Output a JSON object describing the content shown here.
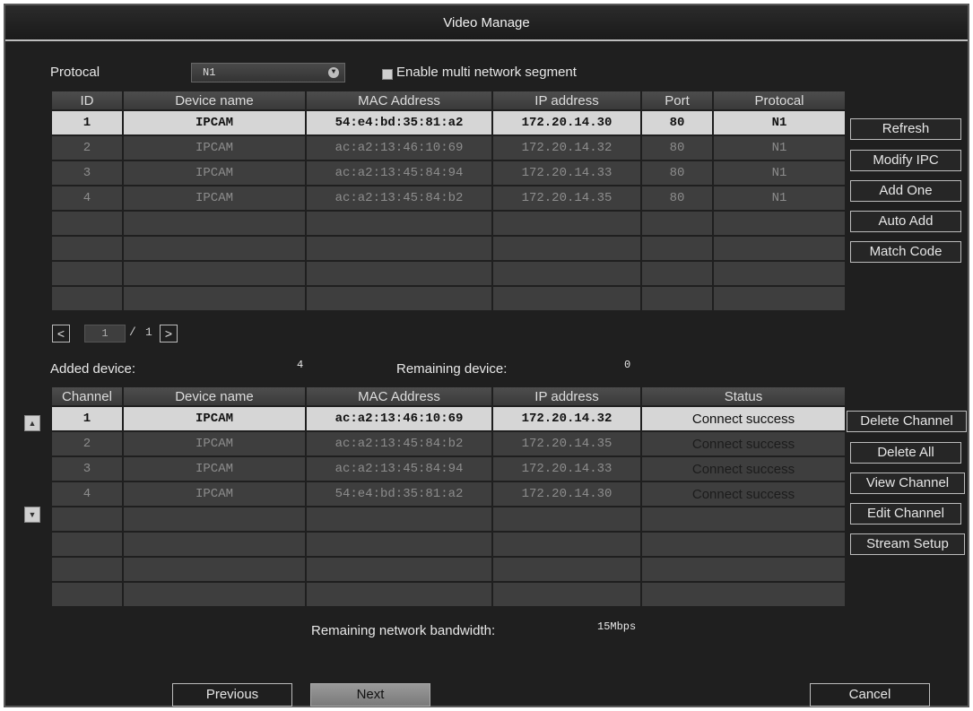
{
  "window": {
    "title": "Video Manage"
  },
  "search": {
    "protocol_label": "Protocal",
    "protocol_value": "N1",
    "multi_segment_label": "Enable multi network segment",
    "multi_segment_checked": true
  },
  "search_table": {
    "headers": [
      "ID",
      "Device name",
      "MAC Address",
      "IP address",
      "Port",
      "Protocal"
    ],
    "rows": [
      [
        "1",
        "IPCAM",
        "54:e4:bd:35:81:a2",
        "172.20.14.30",
        "80",
        "N1"
      ],
      [
        "2",
        "IPCAM",
        "ac:a2:13:46:10:69",
        "172.20.14.32",
        "80",
        "N1"
      ],
      [
        "3",
        "IPCAM",
        "ac:a2:13:45:84:94",
        "172.20.14.33",
        "80",
        "N1"
      ],
      [
        "4",
        "IPCAM",
        "ac:a2:13:45:84:b2",
        "172.20.14.35",
        "80",
        "N1"
      ]
    ],
    "selected_row": 0
  },
  "search_buttons": {
    "refresh": "Refresh",
    "modify_ipc": "Modify IPC",
    "add_one": "Add One",
    "auto_add": "Auto Add",
    "match_code": "Match Code"
  },
  "pager": {
    "prev": "<",
    "current": "1",
    "separator": "/",
    "total": "1",
    "next": ">"
  },
  "summary": {
    "added_label": "Added device:",
    "added_count": "4",
    "remaining_label": "Remaining device:",
    "remaining_count": "0"
  },
  "channel_table": {
    "headers": [
      "Channel",
      "Device name",
      "MAC Address",
      "IP address",
      "Status"
    ],
    "rows": [
      [
        "1",
        "IPCAM",
        "ac:a2:13:46:10:69",
        "172.20.14.32",
        "Connect success"
      ],
      [
        "2",
        "IPCAM",
        "ac:a2:13:45:84:b2",
        "172.20.14.35",
        "Connect success"
      ],
      [
        "3",
        "IPCAM",
        "ac:a2:13:45:84:94",
        "172.20.14.33",
        "Connect success"
      ],
      [
        "4",
        "IPCAM",
        "54:e4:bd:35:81:a2",
        "172.20.14.30",
        "Connect success"
      ]
    ],
    "selected_row": 0
  },
  "channel_buttons": {
    "delete_channel": "Delete Channel",
    "delete_all": "Delete All",
    "view_channel": "View Channel",
    "edit_channel": "Edit Channel",
    "stream_setup": "Stream Setup"
  },
  "order_controls": {
    "up_icon": "triangle-up-icon",
    "down_icon": "triangle-down-icon"
  },
  "bandwidth": {
    "label": "Remaining network bandwidth:",
    "value": "15Mbps"
  },
  "footer": {
    "previous": "Previous",
    "next": "Next",
    "cancel": "Cancel"
  },
  "colors": {
    "background": "#1f1f1f",
    "cell": "#3e3e3e",
    "selected_row": "#d6d6d6",
    "button_border": "#bcbcbc"
  }
}
